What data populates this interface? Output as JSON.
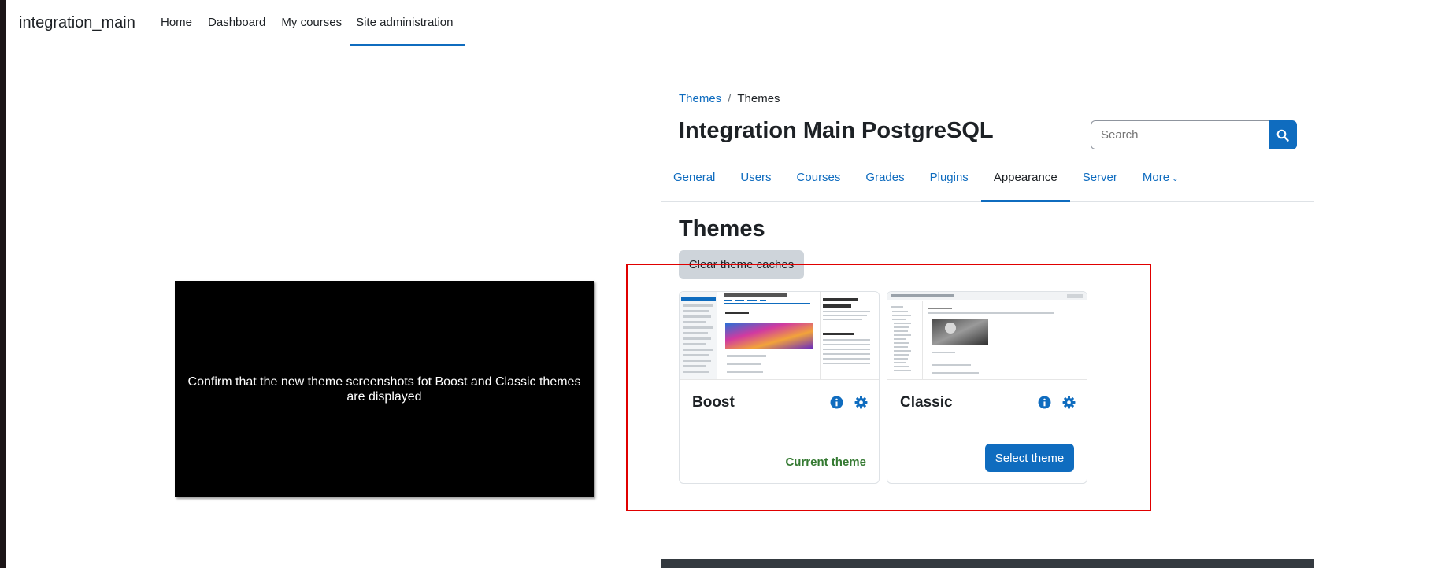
{
  "navbar": {
    "brand": "integration_main",
    "links": [
      "Home",
      "Dashboard",
      "My courses",
      "Site administration"
    ],
    "active_link": "Site administration"
  },
  "video_overlay": {
    "caption": "Confirm that the new theme screenshots fot Boost and Classic themes are displayed"
  },
  "breadcrumb": {
    "link": "Themes",
    "separator": "/",
    "current": "Themes"
  },
  "page_heading": "Integration Main PostgreSQL",
  "search": {
    "placeholder": "Search",
    "icon": "search-icon"
  },
  "tabs": {
    "items": [
      "General",
      "Users",
      "Courses",
      "Grades",
      "Plugins",
      "Appearance",
      "Server",
      "More"
    ],
    "active": "Appearance"
  },
  "section_title": "Themes",
  "clear_caches_label": "Clear theme caches",
  "themes": [
    {
      "name": "Boost",
      "status": "Current theme",
      "icons": [
        "info-icon",
        "gear-icon"
      ]
    },
    {
      "name": "Classic",
      "action": "Select theme",
      "icons": [
        "info-icon",
        "gear-icon"
      ]
    }
  ],
  "colors": {
    "accent": "#0f6cbf",
    "current_theme": "#357a32",
    "highlight_border": "#e00000",
    "dark_footer": "#343a40"
  }
}
